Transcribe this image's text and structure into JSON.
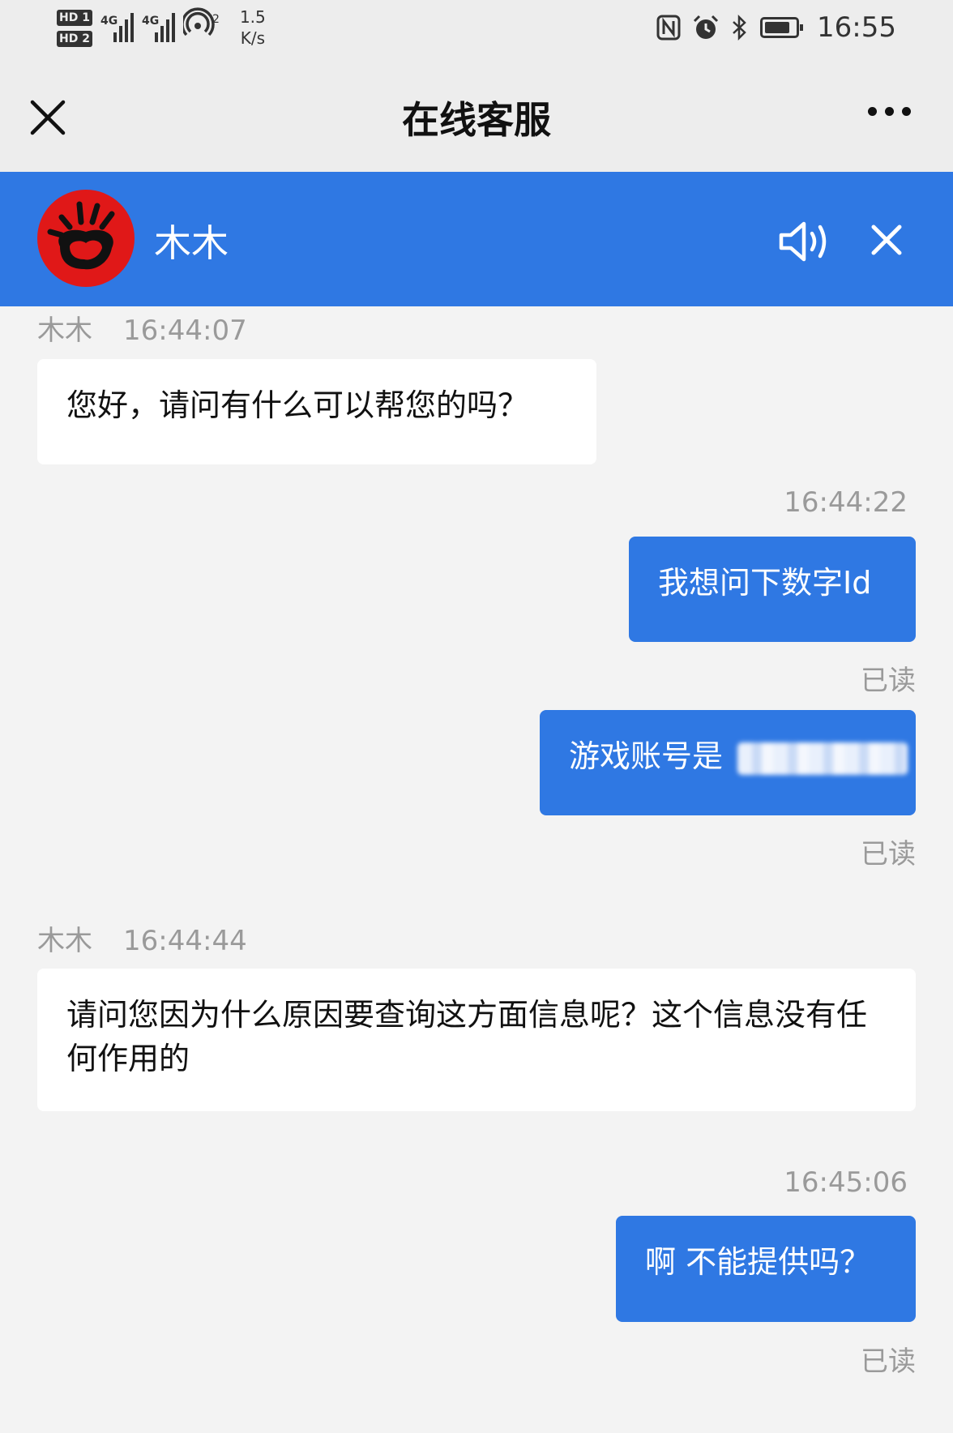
{
  "status_bar": {
    "hd1": "HD 1",
    "hd2": "HD 2",
    "net1": "4G",
    "net2": "4G",
    "hotspot_count": "2",
    "speed_value": "1.5",
    "speed_unit": "K/s",
    "time": "16:55",
    "icons": [
      "nfc-icon",
      "alarm-icon",
      "bluetooth-icon",
      "battery-icon"
    ]
  },
  "header": {
    "title": "在线客服",
    "close_icon": "close-icon",
    "more_icon": "more-icon"
  },
  "agent": {
    "name": "木木",
    "speaker_icon": "speaker-icon",
    "close_icon": "close-icon",
    "avatar_color": "#e01818"
  },
  "theme": {
    "accent": "#2f78e3",
    "background": "#f3f3f3",
    "muted_text": "#9a9a9a"
  },
  "messages": [
    {
      "direction": "in",
      "sender": "木木",
      "time": "16:44:07",
      "text": "您好，请问有什么可以帮您的吗？"
    },
    {
      "direction": "out",
      "time": "16:44:22",
      "text": "我想问下数字Id",
      "status": "已读"
    },
    {
      "direction": "out",
      "text": "游戏账号是 ",
      "status": "已读",
      "redacted": true
    },
    {
      "direction": "in",
      "sender": "木木",
      "time": "16:44:44",
      "text": "请问您因为什么原因要查询这方面信息呢？这个信息没有任何作用的"
    },
    {
      "direction": "out",
      "time": "16:45:06",
      "text": "啊 不能提供吗？",
      "status": "已读"
    }
  ]
}
